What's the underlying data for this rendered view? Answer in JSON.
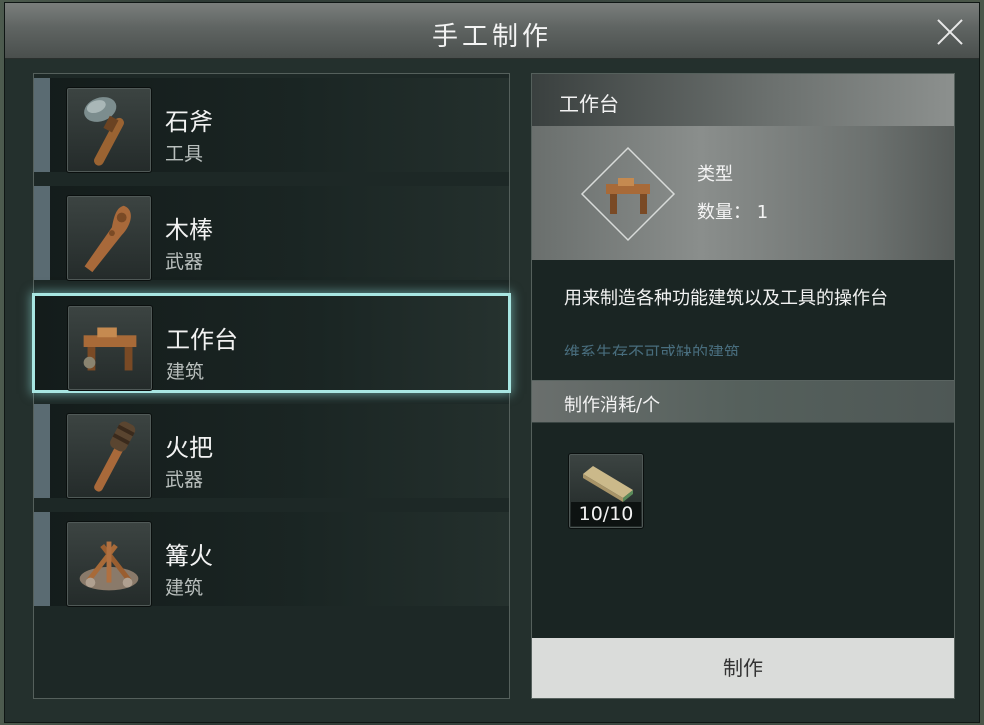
{
  "window": {
    "title": "手工制作"
  },
  "list": {
    "items": [
      {
        "name": "石斧",
        "category": "工具",
        "icon": "stone-axe-icon"
      },
      {
        "name": "木棒",
        "category": "武器",
        "icon": "wooden-club-icon"
      },
      {
        "name": "工作台",
        "category": "建筑",
        "icon": "workbench-icon"
      },
      {
        "name": "火把",
        "category": "武器",
        "icon": "torch-icon"
      },
      {
        "name": "篝火",
        "category": "建筑",
        "icon": "campfire-icon"
      }
    ],
    "selected_index": 2
  },
  "detail": {
    "title": "工作台",
    "type_label": "类型",
    "quantity_label": "数量： 1",
    "description": "用来制造各种功能建筑以及工具的操作台",
    "description_overflow": "维系生存不可或缺的建筑",
    "cost_header": "制作消耗/个",
    "cost_items": [
      {
        "icon": "wood-plank-icon",
        "count": "10/10"
      }
    ],
    "craft_button": "制作"
  },
  "colors": {
    "selection_glow": "#a8e6e2",
    "panel_bg": "#1a2523",
    "button_bg": "#dadcda"
  }
}
